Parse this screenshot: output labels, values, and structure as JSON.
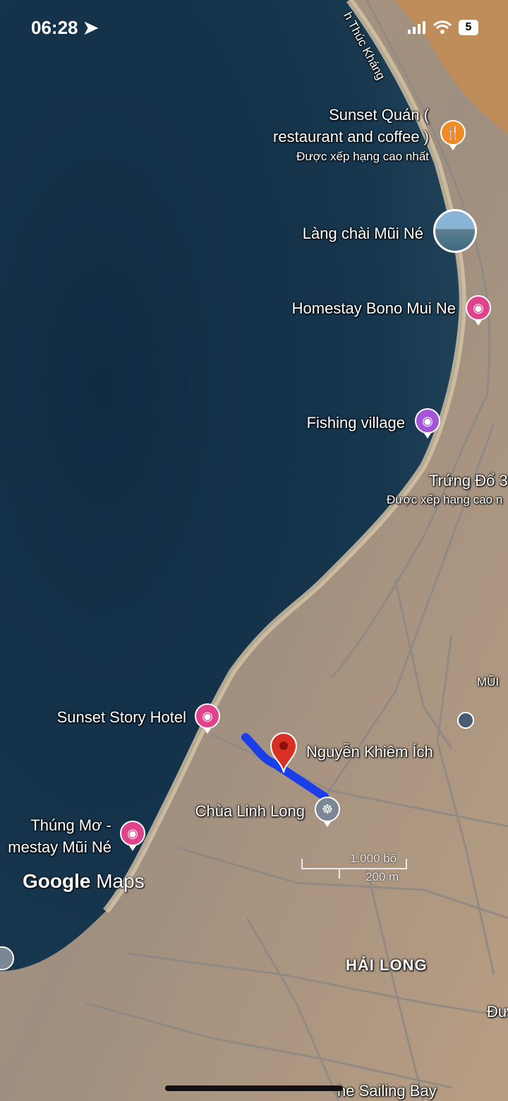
{
  "status_bar": {
    "time": "06:28",
    "battery": "5"
  },
  "map": {
    "road_label": "h Thúc Kháng",
    "places": {
      "sunset_quan": {
        "line1": "Sunset Quán (",
        "line2": "restaurant and coffee )",
        "rating": "Được xếp hạng cao nhất",
        "icon": "fork-knife-icon",
        "color": "#f08a24"
      },
      "lang_chai": {
        "name": "Làng chài Mũi Né",
        "icon": "photo-thumbnail-icon"
      },
      "homestay_bono": {
        "name": "Homestay Bono Mui Ne",
        "icon": "bed-icon",
        "color": "#e0428c"
      },
      "fishing_village": {
        "name": "Fishing village",
        "icon": "camera-icon",
        "color": "#a355d9"
      },
      "trung_do": {
        "name": "Trứng Đổ 3",
        "rating": "Được xếp hạng cao n"
      },
      "mui": {
        "name": "MŨI"
      },
      "sunset_story": {
        "name": "Sunset Story Hotel",
        "icon": "bed-icon",
        "color": "#e0428c"
      },
      "nguyen_khiem_ich": {
        "name": "Nguyễn Khiêm Ích",
        "icon": "red-location-pin-icon",
        "color": "#d93025"
      },
      "chua_linh_long": {
        "name": "Chùa Linh Long",
        "icon": "dharma-wheel-icon",
        "color": "#7b8794"
      },
      "thung_mo": {
        "line1": "Thúng Mơ -",
        "line2": "mestay Mũi Né",
        "icon": "bed-icon",
        "color": "#e0428c"
      },
      "hai_long": {
        "name": "HẢI LONG"
      },
      "sailing_bay": {
        "name": "he Sailing Bay"
      },
      "edge_label": {
        "name": "Đư"
      }
    },
    "scale": {
      "feet": "1.000 bộ",
      "meters": "200 m"
    },
    "attribution": {
      "brand": "Google",
      "product": "Maps"
    }
  }
}
